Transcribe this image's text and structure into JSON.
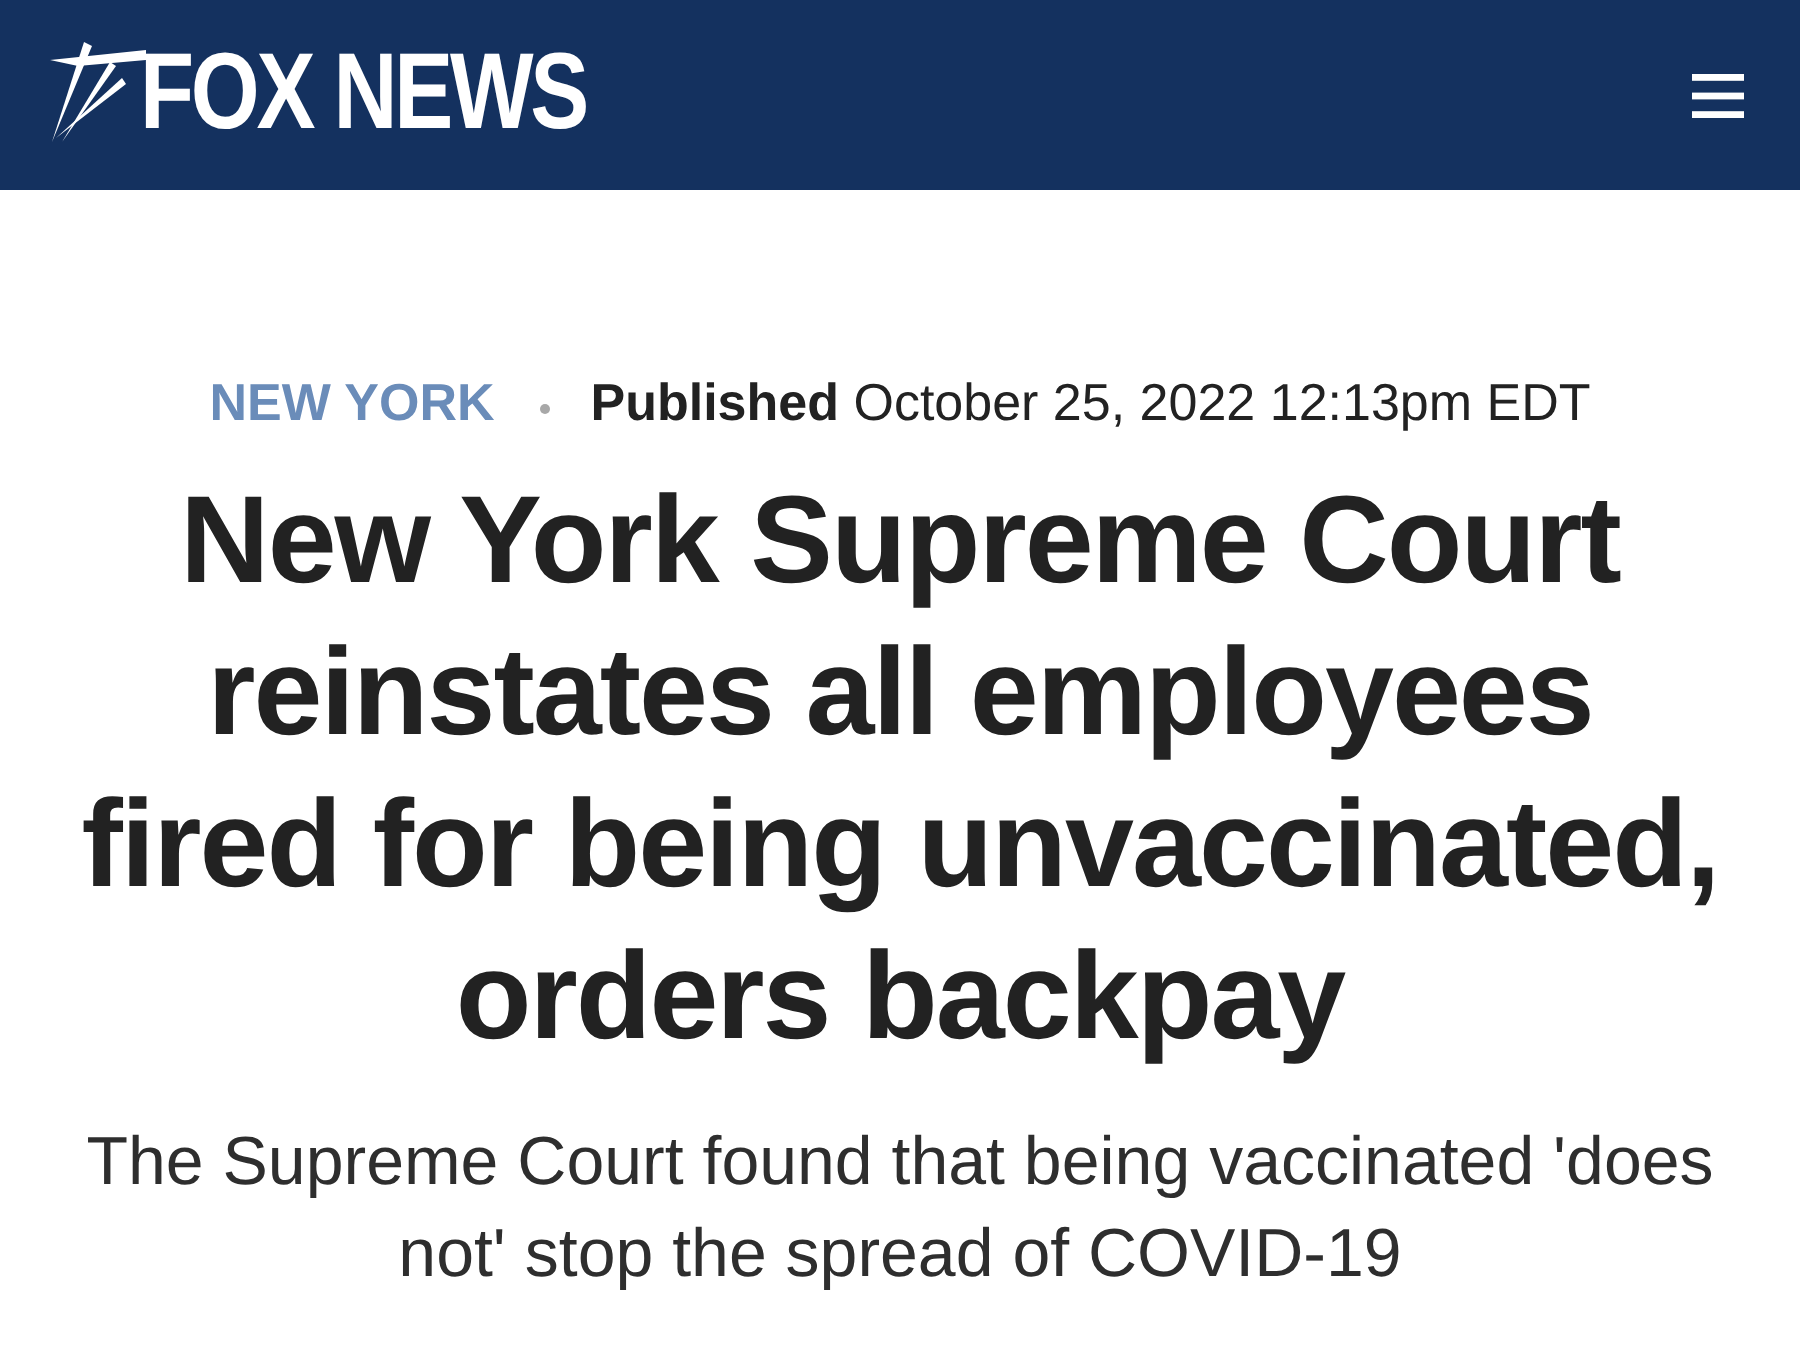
{
  "header": {
    "logo": "FOX NEWS"
  },
  "article": {
    "section": "NEW YORK",
    "published": "**Published** October 25, 2022 12:13pm EDT",
    "headline": "New York Supreme Court reinstates all employees fired for being unvaccinated, orders backpay",
    "subheadline": "The Supreme Court found that being vaccinated 'does not' stop the spread of COVID-19"
  }
}
